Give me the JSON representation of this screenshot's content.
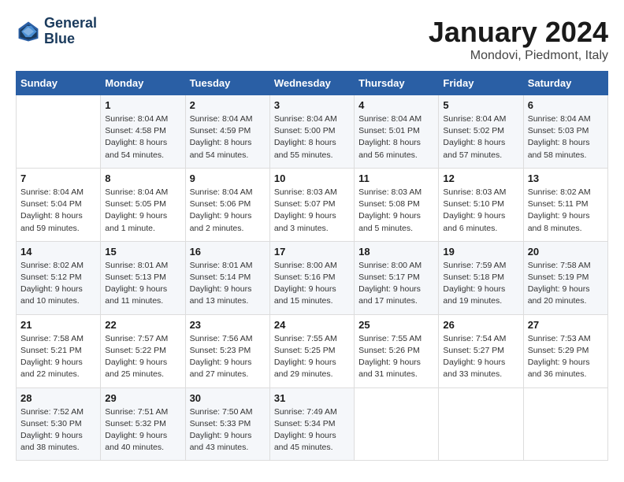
{
  "header": {
    "logo_line1": "General",
    "logo_line2": "Blue",
    "month": "January 2024",
    "location": "Mondovi, Piedmont, Italy"
  },
  "days_of_week": [
    "Sunday",
    "Monday",
    "Tuesday",
    "Wednesday",
    "Thursday",
    "Friday",
    "Saturday"
  ],
  "weeks": [
    [
      {
        "num": "",
        "sunrise": "",
        "sunset": "",
        "daylight": ""
      },
      {
        "num": "1",
        "sunrise": "Sunrise: 8:04 AM",
        "sunset": "Sunset: 4:58 PM",
        "daylight": "Daylight: 8 hours and 54 minutes."
      },
      {
        "num": "2",
        "sunrise": "Sunrise: 8:04 AM",
        "sunset": "Sunset: 4:59 PM",
        "daylight": "Daylight: 8 hours and 54 minutes."
      },
      {
        "num": "3",
        "sunrise": "Sunrise: 8:04 AM",
        "sunset": "Sunset: 5:00 PM",
        "daylight": "Daylight: 8 hours and 55 minutes."
      },
      {
        "num": "4",
        "sunrise": "Sunrise: 8:04 AM",
        "sunset": "Sunset: 5:01 PM",
        "daylight": "Daylight: 8 hours and 56 minutes."
      },
      {
        "num": "5",
        "sunrise": "Sunrise: 8:04 AM",
        "sunset": "Sunset: 5:02 PM",
        "daylight": "Daylight: 8 hours and 57 minutes."
      },
      {
        "num": "6",
        "sunrise": "Sunrise: 8:04 AM",
        "sunset": "Sunset: 5:03 PM",
        "daylight": "Daylight: 8 hours and 58 minutes."
      }
    ],
    [
      {
        "num": "7",
        "sunrise": "Sunrise: 8:04 AM",
        "sunset": "Sunset: 5:04 PM",
        "daylight": "Daylight: 8 hours and 59 minutes."
      },
      {
        "num": "8",
        "sunrise": "Sunrise: 8:04 AM",
        "sunset": "Sunset: 5:05 PM",
        "daylight": "Daylight: 9 hours and 1 minute."
      },
      {
        "num": "9",
        "sunrise": "Sunrise: 8:04 AM",
        "sunset": "Sunset: 5:06 PM",
        "daylight": "Daylight: 9 hours and 2 minutes."
      },
      {
        "num": "10",
        "sunrise": "Sunrise: 8:03 AM",
        "sunset": "Sunset: 5:07 PM",
        "daylight": "Daylight: 9 hours and 3 minutes."
      },
      {
        "num": "11",
        "sunrise": "Sunrise: 8:03 AM",
        "sunset": "Sunset: 5:08 PM",
        "daylight": "Daylight: 9 hours and 5 minutes."
      },
      {
        "num": "12",
        "sunrise": "Sunrise: 8:03 AM",
        "sunset": "Sunset: 5:10 PM",
        "daylight": "Daylight: 9 hours and 6 minutes."
      },
      {
        "num": "13",
        "sunrise": "Sunrise: 8:02 AM",
        "sunset": "Sunset: 5:11 PM",
        "daylight": "Daylight: 9 hours and 8 minutes."
      }
    ],
    [
      {
        "num": "14",
        "sunrise": "Sunrise: 8:02 AM",
        "sunset": "Sunset: 5:12 PM",
        "daylight": "Daylight: 9 hours and 10 minutes."
      },
      {
        "num": "15",
        "sunrise": "Sunrise: 8:01 AM",
        "sunset": "Sunset: 5:13 PM",
        "daylight": "Daylight: 9 hours and 11 minutes."
      },
      {
        "num": "16",
        "sunrise": "Sunrise: 8:01 AM",
        "sunset": "Sunset: 5:14 PM",
        "daylight": "Daylight: 9 hours and 13 minutes."
      },
      {
        "num": "17",
        "sunrise": "Sunrise: 8:00 AM",
        "sunset": "Sunset: 5:16 PM",
        "daylight": "Daylight: 9 hours and 15 minutes."
      },
      {
        "num": "18",
        "sunrise": "Sunrise: 8:00 AM",
        "sunset": "Sunset: 5:17 PM",
        "daylight": "Daylight: 9 hours and 17 minutes."
      },
      {
        "num": "19",
        "sunrise": "Sunrise: 7:59 AM",
        "sunset": "Sunset: 5:18 PM",
        "daylight": "Daylight: 9 hours and 19 minutes."
      },
      {
        "num": "20",
        "sunrise": "Sunrise: 7:58 AM",
        "sunset": "Sunset: 5:19 PM",
        "daylight": "Daylight: 9 hours and 20 minutes."
      }
    ],
    [
      {
        "num": "21",
        "sunrise": "Sunrise: 7:58 AM",
        "sunset": "Sunset: 5:21 PM",
        "daylight": "Daylight: 9 hours and 22 minutes."
      },
      {
        "num": "22",
        "sunrise": "Sunrise: 7:57 AM",
        "sunset": "Sunset: 5:22 PM",
        "daylight": "Daylight: 9 hours and 25 minutes."
      },
      {
        "num": "23",
        "sunrise": "Sunrise: 7:56 AM",
        "sunset": "Sunset: 5:23 PM",
        "daylight": "Daylight: 9 hours and 27 minutes."
      },
      {
        "num": "24",
        "sunrise": "Sunrise: 7:55 AM",
        "sunset": "Sunset: 5:25 PM",
        "daylight": "Daylight: 9 hours and 29 minutes."
      },
      {
        "num": "25",
        "sunrise": "Sunrise: 7:55 AM",
        "sunset": "Sunset: 5:26 PM",
        "daylight": "Daylight: 9 hours and 31 minutes."
      },
      {
        "num": "26",
        "sunrise": "Sunrise: 7:54 AM",
        "sunset": "Sunset: 5:27 PM",
        "daylight": "Daylight: 9 hours and 33 minutes."
      },
      {
        "num": "27",
        "sunrise": "Sunrise: 7:53 AM",
        "sunset": "Sunset: 5:29 PM",
        "daylight": "Daylight: 9 hours and 36 minutes."
      }
    ],
    [
      {
        "num": "28",
        "sunrise": "Sunrise: 7:52 AM",
        "sunset": "Sunset: 5:30 PM",
        "daylight": "Daylight: 9 hours and 38 minutes."
      },
      {
        "num": "29",
        "sunrise": "Sunrise: 7:51 AM",
        "sunset": "Sunset: 5:32 PM",
        "daylight": "Daylight: 9 hours and 40 minutes."
      },
      {
        "num": "30",
        "sunrise": "Sunrise: 7:50 AM",
        "sunset": "Sunset: 5:33 PM",
        "daylight": "Daylight: 9 hours and 43 minutes."
      },
      {
        "num": "31",
        "sunrise": "Sunrise: 7:49 AM",
        "sunset": "Sunset: 5:34 PM",
        "daylight": "Daylight: 9 hours and 45 minutes."
      },
      {
        "num": "",
        "sunrise": "",
        "sunset": "",
        "daylight": ""
      },
      {
        "num": "",
        "sunrise": "",
        "sunset": "",
        "daylight": ""
      },
      {
        "num": "",
        "sunrise": "",
        "sunset": "",
        "daylight": ""
      }
    ]
  ]
}
